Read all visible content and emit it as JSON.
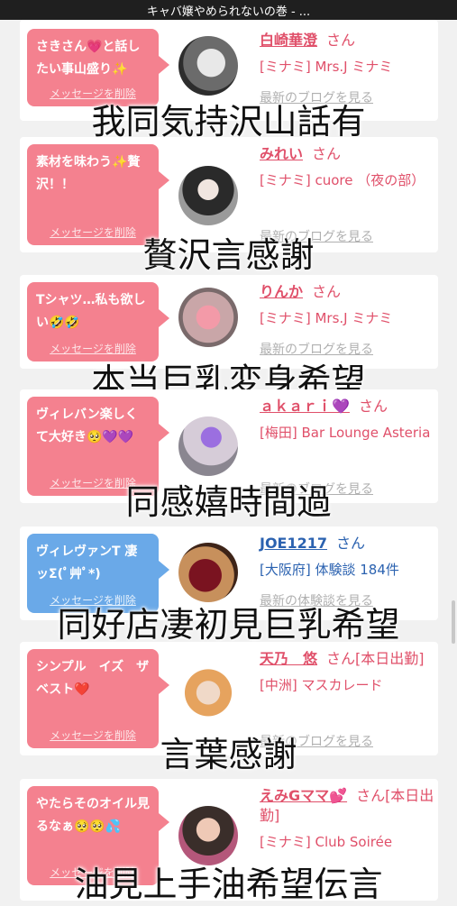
{
  "topbar": {
    "title": "キャバ嬢やめられないの巻 - ..."
  },
  "cards": [
    {
      "message": "さきさん💗と話したい事山盛り✨",
      "delete_label": "メッセージを削除",
      "name": "白崎華澄",
      "suffix": "さん",
      "detail": "[ミナミ] Mrs.J ミナミ",
      "link": "最新のブログを見る",
      "overlay": "我同気持沢山話有",
      "color": "pink"
    },
    {
      "message": "素材を味わう✨贅沢！！",
      "delete_label": "メッセージを削除",
      "name": "みれい",
      "suffix": "さん",
      "detail": "[ミナミ] cuore （夜の部）",
      "link": "最新のブログを見る",
      "overlay": "贅沢言感謝",
      "color": "pink"
    },
    {
      "message": "Tシャツ…私も欲しい🤣🤣",
      "delete_label": "メッセージを削除",
      "name": "りんか",
      "suffix": "さん",
      "detail": "[ミナミ] Mrs.J ミナミ",
      "link": "最新のブログを見る",
      "overlay": "本当巨乳変身希望",
      "color": "pink"
    },
    {
      "message": "ヴィレバン楽しくて大好き🥺💜💜",
      "delete_label": "メッセージを削除",
      "name": "ａｋａｒｉ💜",
      "suffix": "さん",
      "detail": "[梅田] Bar Lounge Asteria",
      "link": "最新のブログを見る",
      "overlay": "同感嬉時間過",
      "color": "pink"
    },
    {
      "message": "ヴィレヴァンT 凄ッΣ(ﾟ艸ﾟ*)",
      "delete_label": "メッセージを削除",
      "name": "JOE1217",
      "suffix": "さん",
      "detail": "[大阪府] 体験談 184件",
      "link": "最新の体験談を見る",
      "overlay": "同好店凄初見巨乳希望",
      "color": "blue"
    },
    {
      "message": "シンプル　イズ　ザ　ベスト❤️",
      "delete_label": "メッセージを削除",
      "name": "天乃　悠",
      "suffix": "さん[本日出勤]",
      "detail": "[中洲] マスカレード",
      "link": "最新のブログを見る",
      "overlay": "言葉感謝",
      "color": "pink"
    },
    {
      "message": "やたらそのオイル見るなぁ🥺🥺💦",
      "delete_label": "メッセージを削除",
      "name": "えみGママ💕",
      "suffix": "さん[本日出勤]",
      "detail": "[ミナミ] Club Soirée",
      "link": "最新のブログを見る",
      "overlay": "油見上手油希望伝言",
      "color": "pink"
    }
  ],
  "icons": {
    "avatar": "profile-photo",
    "scroll": "scrollbar-thumb"
  }
}
